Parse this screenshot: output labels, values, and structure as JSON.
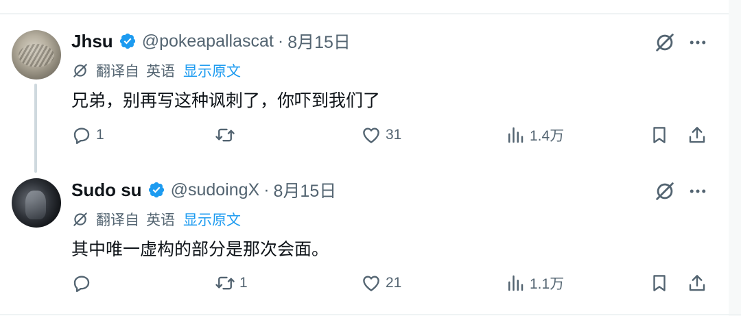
{
  "colors": {
    "accent": "#1d9bf0",
    "text": "#0f1419",
    "secondary": "#536471",
    "divider": "#eff3f4"
  },
  "tweets": [
    {
      "name": "Jhsu",
      "handle": "@pokeapallascat",
      "dot": "·",
      "date": "8月15日",
      "translated_from": "翻译自",
      "language": "英语",
      "show_original": "显示原文",
      "text": "兄弟，别再写这种讽刺了，你吓到我们了",
      "stats": {
        "replies": "1",
        "retweets": "",
        "likes": "31",
        "views": "1.4万"
      }
    },
    {
      "name": "Sudo su",
      "handle": "@sudoingX",
      "dot": "·",
      "date": "8月15日",
      "translated_from": "翻译自",
      "language": "英语",
      "show_original": "显示原文",
      "text": "其中唯一虚构的部分是那次会面。",
      "stats": {
        "replies": "",
        "retweets": "1",
        "likes": "21",
        "views": "1.1万"
      }
    }
  ],
  "icons": [
    "verified-badge-icon",
    "grok-icon",
    "more-icon",
    "translate-icon",
    "reply-icon",
    "retweet-icon",
    "like-icon",
    "views-icon",
    "bookmark-icon",
    "share-icon"
  ]
}
